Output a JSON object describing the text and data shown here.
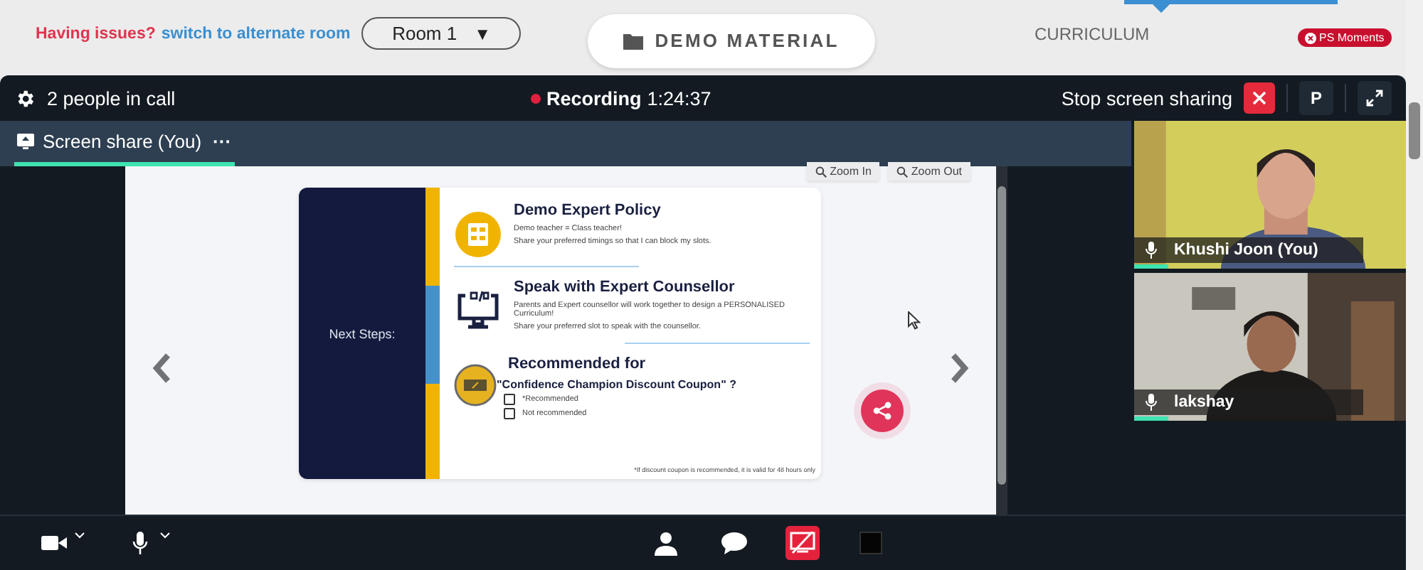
{
  "top_bar": {
    "issue_text": "Having issues?",
    "switch_link": "switch to alternate room",
    "room_select": {
      "value": "Room 1",
      "caret": "▼"
    },
    "demo_button": "DEMO MATERIAL",
    "curriculum": "CURRICULUM",
    "badge": "PS Moments"
  },
  "call_header": {
    "people": "2 people in call",
    "recording_label": "Recording",
    "recording_time": "1:24:37",
    "stop_sharing": "Stop screen sharing",
    "profile_button": "P"
  },
  "tabs": [
    {
      "label": "Screen share (You)",
      "selected": true,
      "menu": "···"
    }
  ],
  "viewer": {
    "zoom_buttons": [
      "Zoom In",
      "Zoom Out"
    ]
  },
  "slide": {
    "side_label": "Next Steps:",
    "sections": [
      {
        "kind": "policy",
        "title": "Demo Expert Policy",
        "lines": [
          "Demo teacher = Class teacher!",
          "Share your preferred timings so that I can block my slots."
        ]
      },
      {
        "kind": "counsellor",
        "title": "Speak with Expert Counsellor",
        "lines": [
          "Parents and Expert counsellor will work together to design a PERSONALISED Curriculum!",
          "Share your preferred slot to speak with the counsellor."
        ]
      },
      {
        "kind": "coupon",
        "title": "Recommended for",
        "lines": [
          "\"Confidence Champion Discount Coupon\" ?"
        ]
      }
    ],
    "options": [
      {
        "label": "*Recommended",
        "checked": false
      },
      {
        "label": "Not recommended",
        "checked": false
      }
    ],
    "footnote": "*If discount coupon is recommended, it is valid for 48 hours only"
  },
  "participants": [
    {
      "name": "Khushi Joon (You)"
    },
    {
      "name": "lakshay"
    }
  ]
}
